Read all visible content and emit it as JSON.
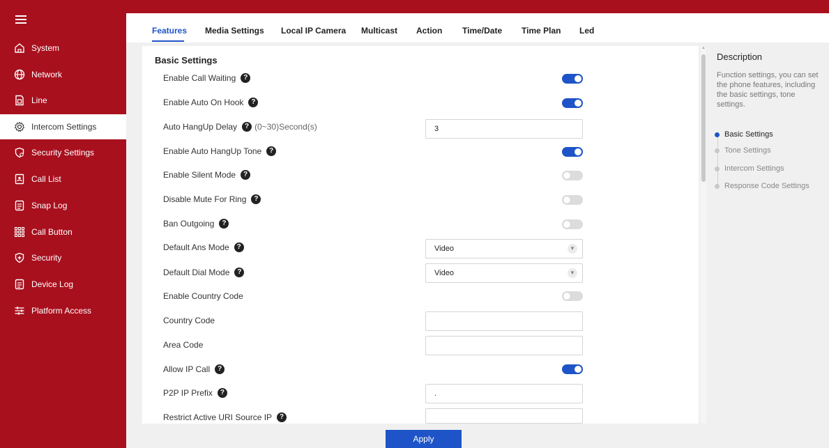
{
  "colors": {
    "brand": "#a8101e",
    "accent": "#1e54c7"
  },
  "sidebar": {
    "items": [
      {
        "label": "System",
        "icon": "home-icon"
      },
      {
        "label": "Network",
        "icon": "globe-icon"
      },
      {
        "label": "Line",
        "icon": "sim-icon"
      },
      {
        "label": "Intercom Settings",
        "icon": "gear-icon"
      },
      {
        "label": "Security Settings",
        "icon": "shield-gear-icon"
      },
      {
        "label": "Call List",
        "icon": "contact-card-icon"
      },
      {
        "label": "Snap Log",
        "icon": "document-icon"
      },
      {
        "label": "Call Button",
        "icon": "keypad-icon"
      },
      {
        "label": "Security",
        "icon": "shield-plus-icon"
      },
      {
        "label": "Device Log",
        "icon": "log-icon"
      },
      {
        "label": "Platform Access",
        "icon": "sliders-icon"
      }
    ],
    "active_index": 3
  },
  "tabs": [
    "Features",
    "Media Settings",
    "Local IP Camera",
    "Multicast",
    "Action",
    "Time/Date",
    "Time Plan",
    "Led"
  ],
  "active_tab": "Features",
  "form": {
    "section_title": "Basic Settings",
    "rows": [
      {
        "label": "Enable Call Waiting",
        "help": "?",
        "control": "toggle",
        "value": true
      },
      {
        "label": "Enable Auto On Hook",
        "help": "?",
        "control": "toggle",
        "value": true
      },
      {
        "label": "Auto HangUp Delay",
        "help": "?",
        "hint": "(0~30)Second(s)",
        "control": "input",
        "value": "3"
      },
      {
        "label": "Enable Auto HangUp Tone",
        "help": "?",
        "control": "toggle",
        "value": true
      },
      {
        "label": "Enable Silent Mode",
        "help": "?",
        "control": "toggle",
        "value": false
      },
      {
        "label": "Disable Mute For Ring",
        "help": "?",
        "control": "toggle",
        "value": false
      },
      {
        "label": "Ban Outgoing",
        "help": "?",
        "control": "toggle",
        "value": false
      },
      {
        "label": "Default Ans Mode",
        "help": "?",
        "control": "select",
        "value": "Video"
      },
      {
        "label": "Default Dial Mode",
        "help": "?",
        "control": "select",
        "value": "Video"
      },
      {
        "label": "Enable Country Code",
        "control": "toggle",
        "value": false
      },
      {
        "label": "Country Code",
        "control": "input",
        "value": ""
      },
      {
        "label": "Area Code",
        "control": "input",
        "value": ""
      },
      {
        "label": "Allow IP Call",
        "help": "?",
        "control": "toggle",
        "value": true
      },
      {
        "label": "P2P IP Prefix",
        "help": "?",
        "control": "input",
        "value": "."
      },
      {
        "label": "Restrict Active URI Source IP",
        "help": "?",
        "control": "input",
        "value": ""
      }
    ],
    "apply_label": "Apply"
  },
  "description": {
    "title": "Description",
    "text": "Function settings, you can set the phone features, including the basic settings, tone settings.",
    "anchors": [
      "Basic Settings",
      "Tone Settings",
      "Intercom Settings",
      "Response Code Settings"
    ],
    "active_anchor": "Basic Settings"
  }
}
